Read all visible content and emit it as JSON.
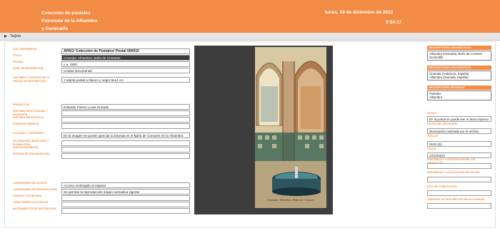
{
  "header": {
    "title_lines": [
      "Colección de postales",
      "Patronato de la Alhambra",
      "y Generalife"
    ],
    "date": "lunes, 19 de diciembre de 2022",
    "time": "9:54:17"
  },
  "tabs": [
    {
      "label": "Tarjeta"
    }
  ],
  "form": {
    "fields": [
      {
        "label": "CÓD. REFERENCIA",
        "value": "APAG/ Colección de Postales/ Postal 000010",
        "bold": true
      },
      {
        "label": "TÍTULO",
        "value": "Granada. Alhambra. Baño de Comares",
        "select": true
      },
      {
        "label": "FECHAS",
        "value": "c.a. 1900"
      },
      {
        "label": "NIVEL DE DESCRIPCIÓN",
        "value": "Unidad documental"
      },
      {
        "label": "VOLUMEN Y SOPORTE DE LA UNIDAD DE DESCRIPCIÓN",
        "value": "1 tarjeta postal a blanco y negro 9x14 cm"
      },
      {
        "label": "PRODUCTOR",
        "value": "Eduardo Puerto Lucas Hurtado"
      },
      {
        "label": "HISTORIA INSTITUCIONAL / BIOGRAFÍA",
        "value": ""
      },
      {
        "label": "HISTORIA ARCHIVÍSTICA",
        "value": ""
      },
      {
        "label": "FORMA DE INGRESO",
        "value": ""
      },
      {
        "label": "ALCANCE Y CONTENIDO",
        "value": "En la imagen se puede apreciar la bóveda en el Baño de Comares en la Alhambra"
      },
      {
        "label": "VALORACIÓN, SELECCIÓN Y ELIMINACIÓN",
        "value": ""
      },
      {
        "label": "NUEVOS INGRESOS",
        "value": ""
      },
      {
        "label": "SISTEMA DE ORGANIZACIÓN",
        "value": ""
      },
      {
        "label": "CONDICIONES DE ACCESO",
        "value": "Acceso restringido al original"
      },
      {
        "label": "CONDICIONES DE REPRODUCCIÓN",
        "value": "Se permite la reproducción según normativa vigente"
      },
      {
        "label": "LENGUA Y ESCRITURA",
        "value": ""
      },
      {
        "label": "CARACTERÍSTICAS FÍSICAS",
        "value": ""
      },
      {
        "label": "INSTRUMENTOS DE DESCRIPCIÓN",
        "value": ""
      }
    ]
  },
  "image": {
    "caption": "Granada. Alhambra. Baño de Comares"
  },
  "right_panel": {
    "descriptores_onomasticos": {
      "title": "DESCRIPTORES ONOMÁSTICOS",
      "items": [
        "Alhambra (Granada). Baño de Comares",
        "Generalife"
      ]
    },
    "descriptores_geograficos": {
      "title": "DESCRIPTORES GEOGRÁFICOS",
      "items": [
        "Granada (Andalucía, España)",
        "Alhambra (Granada, España)"
      ]
    },
    "descriptores_materias": {
      "title": "DESCRIPTORES MATERIAS",
      "items": [
        "Postales",
        "Alhambra"
      ]
    },
    "fields": [
      {
        "label": "NOTAS",
        "value": ""
      },
      {
        "label": "",
        "value": "En la postal se puede leer el texto impreso"
      },
      {
        "label": "NOTAS DEL ARCHIVERO",
        "value": ""
      },
      {
        "label": "",
        "value": "Descripción realizada por el archivo"
      },
      {
        "label": "REGLAS",
        "value": ""
      },
      {
        "label": "",
        "value": "ISAD (G)"
      },
      {
        "label": "FECHA",
        "value": ""
      },
      {
        "label": "",
        "value": "12/12/2022"
      },
      {
        "label": "EXISTENCIA Y LOCALIZACIÓN DE LOS ORIGINALES",
        "value": ""
      },
      {
        "label": "EXISTENCIA Y LOCALIZACIÓN DE COPIAS",
        "value": ""
      },
      {
        "label": "NOTA DE PUBLICACIÓN",
        "value": ""
      },
      {
        "label": "UNIDADES DE DESCRIPCIÓN RELACIONADAS",
        "value": ""
      }
    ]
  }
}
